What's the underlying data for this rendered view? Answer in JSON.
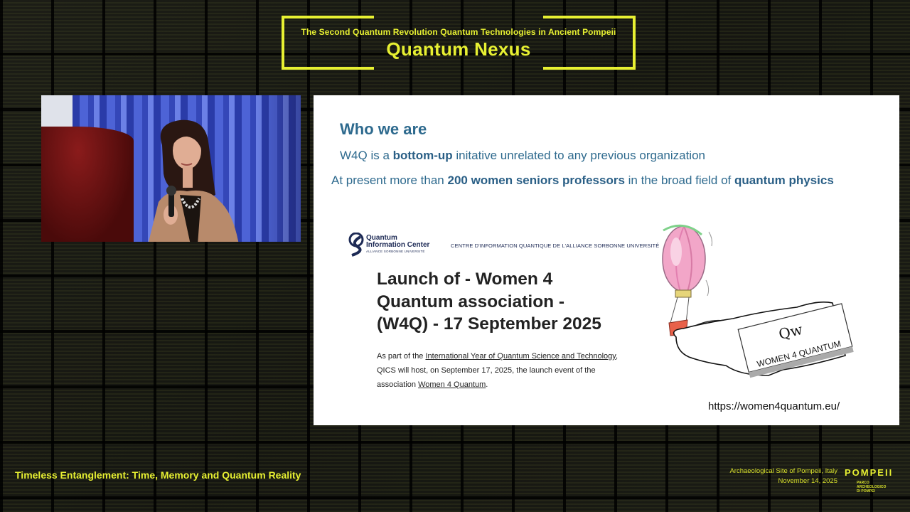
{
  "header": {
    "subtitle": "The Second  Quantum Revolution Quantum Technologies in Ancient Pompeii",
    "title": "Quantum Nexus"
  },
  "slide": {
    "heading": "Who we are",
    "line1": {
      "prefix": "W4Q is a ",
      "bold": "bottom-up",
      "suffix": " initative unrelated to any previous organization"
    },
    "line2": {
      "prefix": "At present more than ",
      "bold1": "200 women seniors professors",
      "mid": " in the broad field of ",
      "bold2": "quantum physics"
    },
    "qic": {
      "name_line1": "Quantum",
      "name_line2": "Information Center",
      "subline": "ALLIANCE SORBONNE UNIVERSITÉ",
      "center": "CENTRE D'INFORMATION QUANTIQUE DE L'ALLIANCE SORBONNE UNIVERSITÉ"
    },
    "launch": {
      "title_l1": "Launch of - Women 4",
      "title_l2": "Quantum association -",
      "title_l3": "(W4Q) - 17 September 2025",
      "body_p1": "As part of the ",
      "body_link1": "International Year of Quantum Science and Technology",
      "body_p2": ", QICS will host, on September 17, 2025, the launch event of the association ",
      "body_link2": "Women 4 Quantum",
      "body_p3": "."
    },
    "illustration": {
      "logo": "Qw",
      "label": "WOMEN 4 QUANTUM"
    },
    "url": "https://women4quantum.eu/"
  },
  "footer": {
    "left": "Timeless Entanglement: Time, Memory and Quantum Reality",
    "location": "Archaeological Site of Pompeii, Italy",
    "date": "November 14, 2025",
    "logo_word": "POMPEII",
    "logo_sub_l1": "PARCO",
    "logo_sub_l2": "ARCHEOLOGICO",
    "logo_sub_l3": "DI POMPEI"
  },
  "colors": {
    "accent": "#e7f032",
    "slide_text": "#2e6a8e",
    "background": "#0c0c0b"
  }
}
